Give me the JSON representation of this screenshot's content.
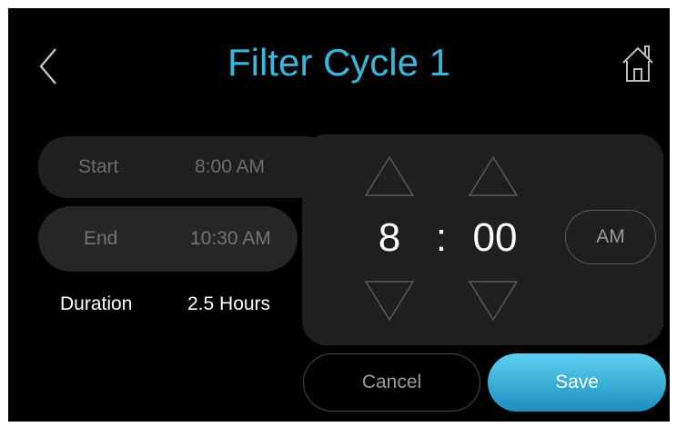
{
  "header": {
    "title": "Filter Cycle 1",
    "back_icon": "chevron-left-icon",
    "home_icon": "home-icon"
  },
  "schedule": {
    "start_label": "Start",
    "start_value": "8:00 AM",
    "end_label": "End",
    "end_value": "10:30 AM",
    "duration_label": "Duration",
    "duration_value": "2.5 Hours"
  },
  "time_picker": {
    "hour": "8",
    "separator": ":",
    "minute": "00",
    "period": "AM"
  },
  "actions": {
    "cancel_label": "Cancel",
    "save_label": "Save"
  },
  "colors": {
    "accent": "#3bb6d8",
    "background": "#000000",
    "panel": "#1f1f1f"
  }
}
